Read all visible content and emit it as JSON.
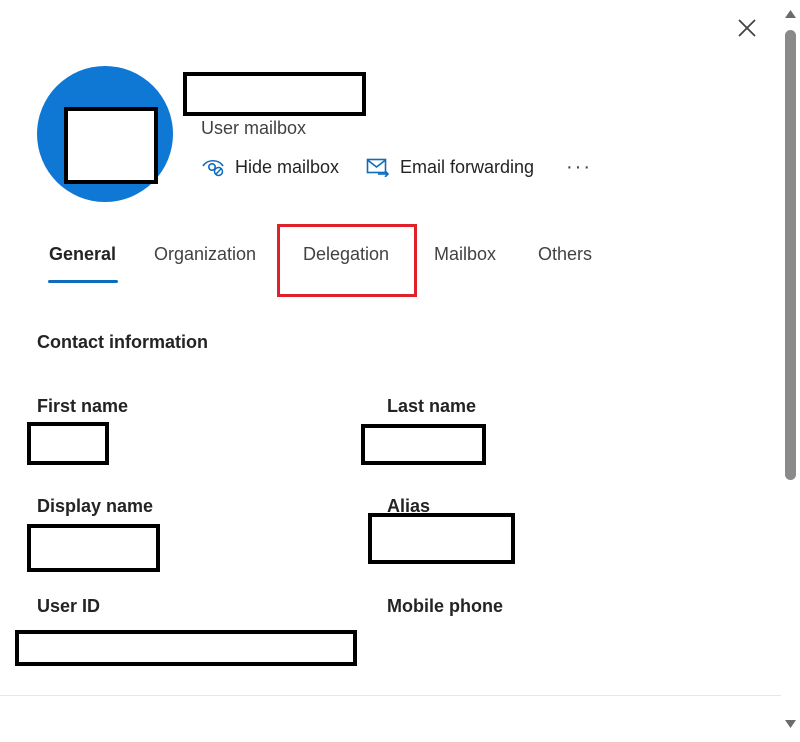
{
  "header": {
    "subtitle": "User mailbox",
    "actions": {
      "hide_mailbox": "Hide mailbox",
      "email_forwarding": "Email forwarding",
      "more": "···"
    }
  },
  "tabs": [
    {
      "label": "General",
      "selected": true
    },
    {
      "label": "Organization",
      "selected": false
    },
    {
      "label": "Delegation",
      "selected": false
    },
    {
      "label": "Mailbox",
      "selected": false
    },
    {
      "label": "Others",
      "selected": false
    }
  ],
  "contact": {
    "section_title": "Contact information",
    "first_name_label": "First name",
    "last_name_label": "Last name",
    "display_name_label": "Display name",
    "alias_label": "Alias",
    "user_id_label": "User ID",
    "mobile_phone_label": "Mobile phone"
  },
  "colors": {
    "avatar": "#0f78d4",
    "accent": "#0f6cbd",
    "highlight": "#e0202b"
  },
  "icons": {
    "close": "close-icon",
    "hide": "eye-hide-icon",
    "forward": "mail-forward-icon"
  }
}
